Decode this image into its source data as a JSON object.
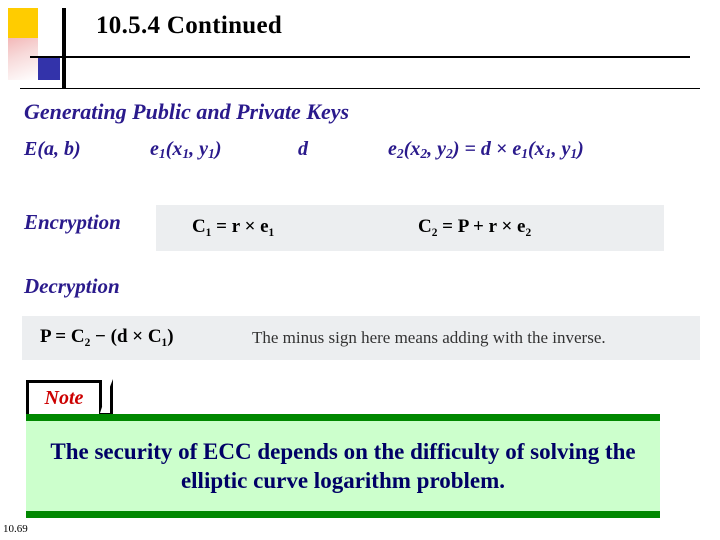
{
  "slide": {
    "title": "10.5.4  Continued",
    "footer": "10.69"
  },
  "section": {
    "subhead": "Generating Public and Private Keys"
  },
  "keys_row": {
    "item1": "E(a, b)",
    "item2_pre": "e",
    "item2_sub": "1",
    "item2_post": "(x",
    "item2_sub2": "1",
    "item2_mid": ", y",
    "item2_sub3": "1",
    "item2_end": ")",
    "item3": "d",
    "item4": "e₂(x₂, y₂) = d × e₁(x₁, y₁)"
  },
  "encryption": {
    "label": "Encryption",
    "formula1": "C₁ = r × e₁",
    "formula2": "C₂ = P + r × e₂"
  },
  "decryption": {
    "label": "Decryption",
    "formula": "P = C₂ − (d × C₁)",
    "note": "The minus sign here means adding with the inverse."
  },
  "note_box": {
    "tab_label": "Note",
    "text": "The security of ECC depends on the difficulty of solving the elliptic curve logarithm problem."
  },
  "colors": {
    "heading_blue": "#2a1a8c",
    "note_green_border": "#008800",
    "note_green_fill": "#ccffcc",
    "note_text_blue": "#000066",
    "note_tab_red": "#cc0000",
    "deco_yellow": "#ffcc00",
    "deco_blue": "#3333aa",
    "formula_box_grey": "#eceef0"
  }
}
